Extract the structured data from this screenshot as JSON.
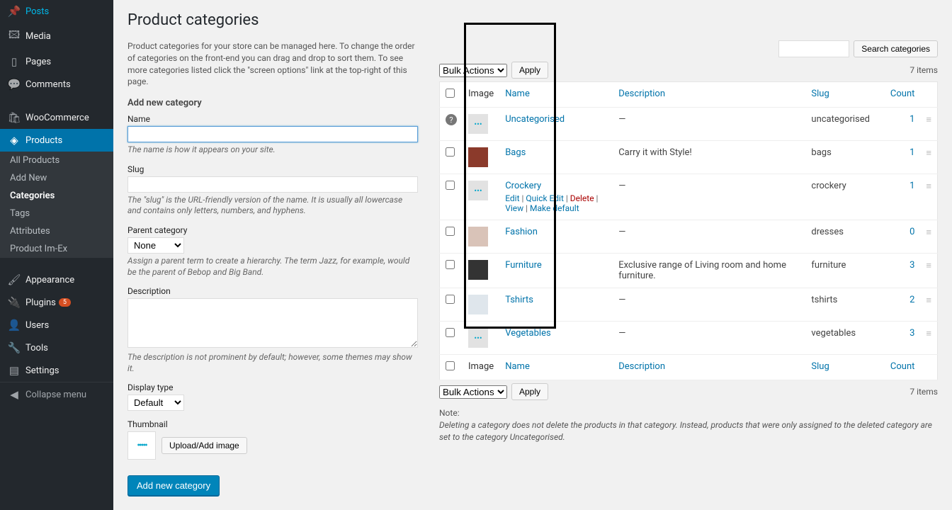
{
  "sidebar": {
    "items": [
      {
        "icon": "📌",
        "label": "Posts"
      },
      {
        "icon": "🖾",
        "label": "Media"
      },
      {
        "icon": "▯",
        "label": "Pages"
      },
      {
        "icon": "💬",
        "label": "Comments"
      }
    ],
    "items2": [
      {
        "icon": "🛍",
        "label": "WooCommerce"
      },
      {
        "icon": "◈",
        "label": "Products",
        "active": true
      }
    ],
    "submenu": [
      {
        "label": "All Products"
      },
      {
        "label": "Add New"
      },
      {
        "label": "Categories",
        "active": true
      },
      {
        "label": "Tags"
      },
      {
        "label": "Attributes"
      },
      {
        "label": "Product Im-Ex"
      }
    ],
    "items3": [
      {
        "icon": "🖌",
        "label": "Appearance"
      },
      {
        "icon": "🔌",
        "label": "Plugins",
        "badge": "5"
      },
      {
        "icon": "👤",
        "label": "Users"
      },
      {
        "icon": "🔧",
        "label": "Tools"
      },
      {
        "icon": "▤",
        "label": "Settings"
      }
    ],
    "collapse": "Collapse menu"
  },
  "page": {
    "title": "Product categories",
    "intro": "Product categories for your store can be managed here. To change the order of categories on the front-end you can drag and drop to sort them. To see more categories listed click the \"screen options\" link at the top-right of this page."
  },
  "form": {
    "heading": "Add new category",
    "name_label": "Name",
    "name_help": "The name is how it appears on your site.",
    "slug_label": "Slug",
    "slug_help": "The \"slug\" is the URL-friendly version of the name. It is usually all lowercase and contains only letters, numbers, and hyphens.",
    "parent_label": "Parent category",
    "parent_value": "None",
    "parent_help": "Assign a parent term to create a hierarchy. The term Jazz, for example, would be the parent of Bebop and Big Band.",
    "desc_label": "Description",
    "desc_help": "The description is not prominent by default; however, some themes may show it.",
    "display_label": "Display type",
    "display_value": "Default",
    "thumb_label": "Thumbnail",
    "upload_btn": "Upload/Add image",
    "submit": "Add new category"
  },
  "table": {
    "search_btn": "Search categories",
    "bulk_label": "Bulk Actions",
    "apply": "Apply",
    "items_count": "7 items",
    "headers": {
      "image": "Image",
      "name": "Name",
      "description": "Description",
      "slug": "Slug",
      "count": "Count"
    },
    "row_actions": {
      "edit": "Edit",
      "quick": "Quick Edit",
      "delete": "Delete",
      "view": "View",
      "default": "Make default"
    },
    "rows": [
      {
        "name": "Uncategorised",
        "desc": "—",
        "slug": "uncategorised",
        "count": "1",
        "thumb": "woo"
      },
      {
        "name": "Bags",
        "desc": "Carry it with Style!",
        "slug": "bags",
        "count": "1",
        "thumb": "bags"
      },
      {
        "name": "Crockery",
        "desc": "—",
        "slug": "crockery",
        "count": "1",
        "thumb": "woo",
        "hovered": true
      },
      {
        "name": "Fashion",
        "desc": "—",
        "slug": "dresses",
        "count": "0",
        "thumb": "dresses"
      },
      {
        "name": "Furniture",
        "desc": "Exclusive range of Living room and home furniture.",
        "slug": "furniture",
        "count": "3",
        "thumb": "furn"
      },
      {
        "name": "Tshirts",
        "desc": "—",
        "slug": "tshirts",
        "count": "2",
        "thumb": "tshirt"
      },
      {
        "name": "Vegetables",
        "desc": "—",
        "slug": "vegetables",
        "count": "3",
        "thumb": "woo"
      }
    ]
  },
  "note": {
    "label": "Note:",
    "text": "Deleting a category does not delete the products in that category. Instead, products that were only assigned to the deleted category are set to the category Uncategorised."
  }
}
